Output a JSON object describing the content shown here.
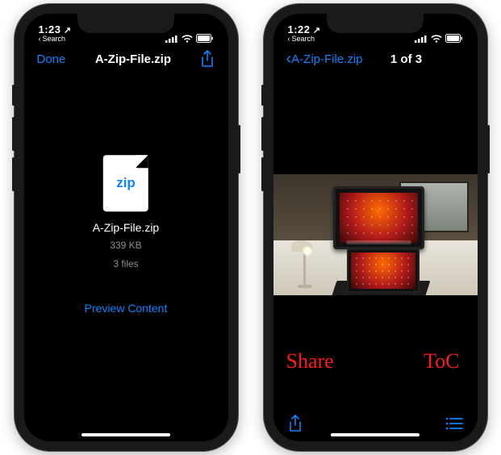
{
  "left": {
    "status": {
      "time": "1:23",
      "time_suffix": "↗",
      "back_app": "Search"
    },
    "nav": {
      "done": "Done",
      "title": "A-Zip-File.zip"
    },
    "file": {
      "icon_label": "zip",
      "name": "A-Zip-File.zip",
      "size": "339 KB",
      "count": "3 files"
    },
    "preview": "Preview Content"
  },
  "right": {
    "status": {
      "time": "1:22",
      "time_suffix": "↗",
      "back_app": "Search"
    },
    "nav": {
      "back": "A-Zip-File.zip",
      "position": "1 of 3"
    },
    "annotations": {
      "share": "Share",
      "toc": "ToC"
    }
  },
  "colors": {
    "ios_blue": "#0a84ff",
    "annotation_red": "#ff1a1a"
  }
}
